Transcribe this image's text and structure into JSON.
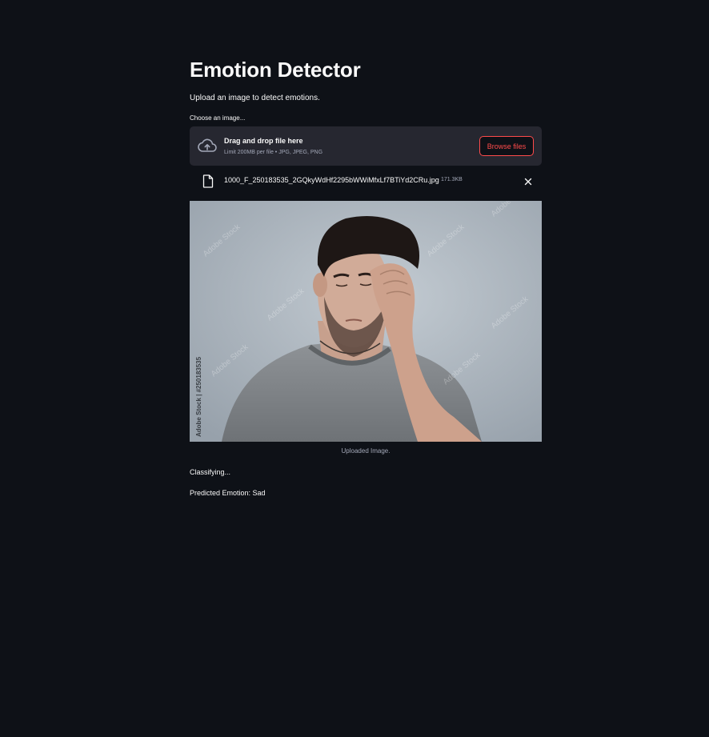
{
  "app": {
    "title": "Emotion Detector",
    "subtitle": "Upload an image to detect emotions."
  },
  "uploader": {
    "label": "Choose an image...",
    "drop_title": "Drag and drop file here",
    "limit_text": "Limit 200MB per file • JPG, JPEG, PNG",
    "browse_label": "Browse files",
    "icon": "cloud-upload-icon"
  },
  "file": {
    "name": "1000_F_250183535_2GQkyWdHf2295bWWiMfxLf7BTiYd2CRu.jpg",
    "size": "171.3KB",
    "icon": "file-icon",
    "remove_icon": "close-icon"
  },
  "image": {
    "watermark": "Adobe Stock",
    "side_text": "Adobe Stock | #250183535",
    "caption": "Uploaded Image."
  },
  "result": {
    "status": "Classifying...",
    "prediction": "Predicted Emotion: Sad"
  },
  "colors": {
    "background": "#0e1117",
    "panel": "#262730",
    "accent": "#ff4b4b",
    "text": "#fafafa",
    "muted": "#a3a8b8"
  }
}
